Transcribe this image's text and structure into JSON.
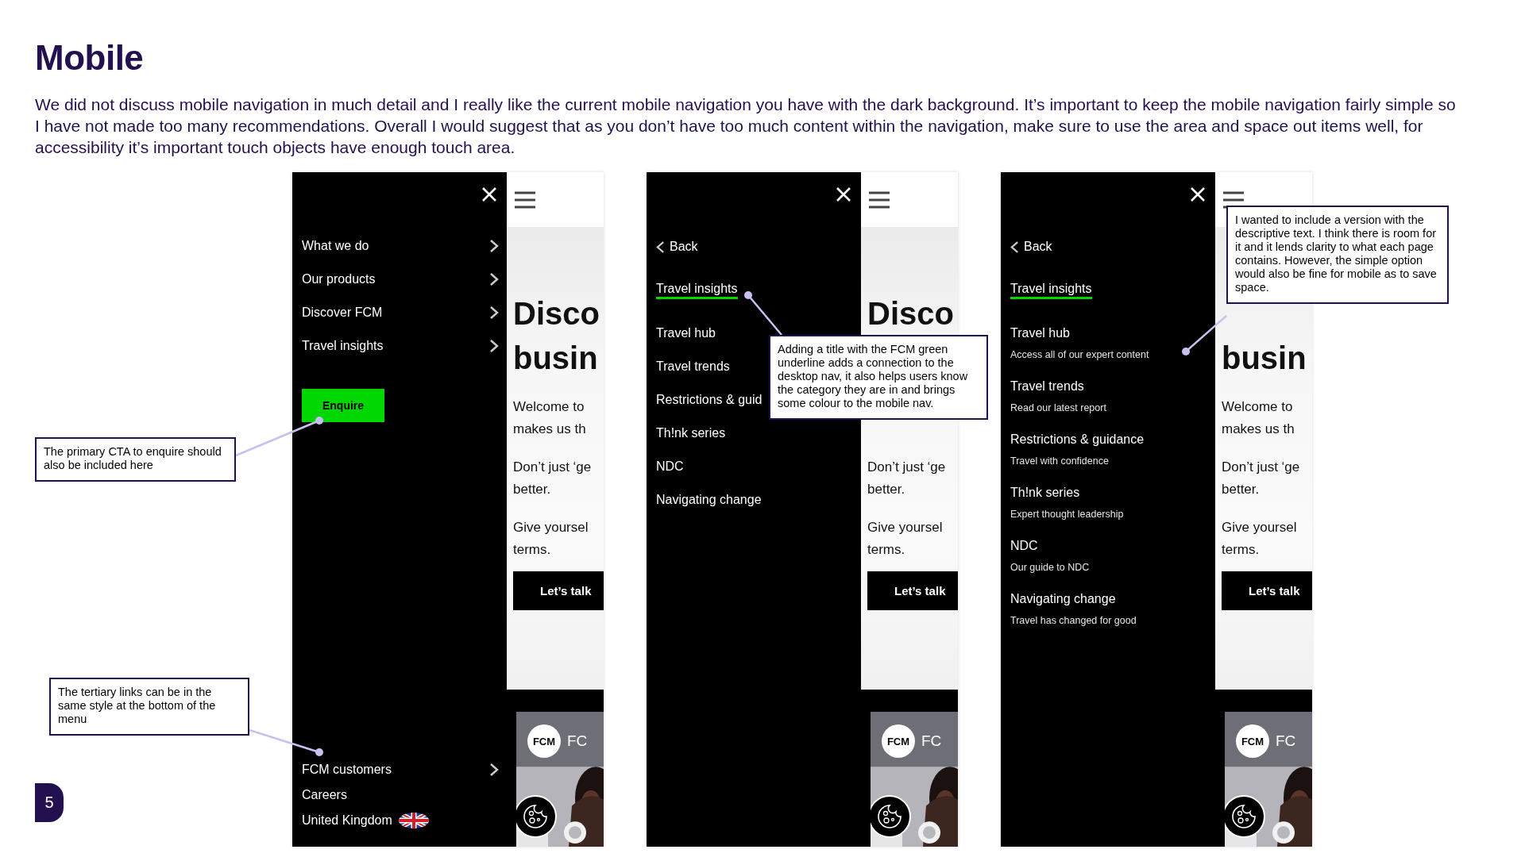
{
  "title": "Mobile",
  "intro": "We did not discuss mobile navigation in much detail and I really like the current mobile navigation you have with the dark background. It’s important to keep the mobile navigation fairly simple so I have not made too many recommendations. Overall I would suggest that as you don’t have too much content within the navigation, make sure to use the area and space out items well, for accessibility it’s important touch objects have enough touch area.",
  "phones": [
    {
      "menu": {
        "kind": "main",
        "items": [
          {
            "label": "What we do",
            "has_submenu": true
          },
          {
            "label": "Our products",
            "has_submenu": true
          },
          {
            "label": "Discover FCM",
            "has_submenu": true
          },
          {
            "label": "Travel insights",
            "has_submenu": true
          }
        ],
        "cta": "Enquire",
        "footer_links": [
          {
            "label": "FCM customers",
            "kind": "submenu"
          },
          {
            "label": "Careers",
            "kind": "link"
          },
          {
            "label": "United Kingdom",
            "kind": "country"
          }
        ]
      },
      "page": {
        "blocks": [
          {
            "kind": "heading",
            "lines": [
              "Disco",
              "busin"
            ],
            "covered": false
          },
          {
            "kind": "para",
            "lines": [
              "Welcome to",
              "makes us th"
            ],
            "covered": false
          },
          {
            "kind": "para",
            "lines": [
              "Don’t just ‘ge",
              "better."
            ],
            "covered": false
          },
          {
            "kind": "para",
            "lines": [
              "Give yoursel",
              "terms."
            ],
            "covered": false
          }
        ],
        "button": "Let’s talk",
        "logo": "FCM",
        "logo_caption": "FC"
      }
    },
    {
      "menu": {
        "kind": "section",
        "back": "Back",
        "section_title": "Travel insights",
        "items": [
          {
            "label": "Travel hub"
          },
          {
            "label": "Travel trends"
          },
          {
            "label": "Restrictions & guid"
          },
          {
            "label": "Th!nk series"
          },
          {
            "label": "NDC"
          },
          {
            "label": "Navigating change"
          }
        ]
      },
      "page": {
        "blocks": [
          {
            "kind": "heading",
            "lines": [
              "Disco"
            ],
            "covered": false
          },
          {
            "kind": "para"
          },
          {
            "kind": "para",
            "lines": [
              "Don’t just ‘ge",
              "better."
            ],
            "covered": false
          },
          {
            "kind": "para",
            "lines": [
              "Give yoursel",
              "terms."
            ],
            "covered": false
          }
        ],
        "button": "Let’s talk",
        "logo": "FCM",
        "logo_caption": "FC"
      }
    },
    {
      "menu": {
        "kind": "section",
        "back": "Back",
        "section_title": "Travel insights",
        "items": [
          {
            "label": "Travel hub",
            "description": "Access all of our expert content"
          },
          {
            "label": "Travel trends",
            "description": "Read our latest report"
          },
          {
            "label": "Restrictions & guidance",
            "description": "Travel with confidence"
          },
          {
            "label": "Th!nk series",
            "description": "Expert thought leadership"
          },
          {
            "label": "NDC",
            "description": "Our guide to NDC"
          },
          {
            "label": "Navigating change",
            "description": "Travel has changed for good"
          }
        ]
      },
      "page": {
        "blocks": [
          {
            "kind": "heading",
            "lines": [
              "busin"
            ],
            "covered": true
          },
          {
            "kind": "para",
            "lines": [
              "Welcome to",
              "makes us th"
            ],
            "covered": false
          },
          {
            "kind": "para",
            "lines": [
              "Don’t just ‘ge",
              "better."
            ],
            "covered": false
          },
          {
            "kind": "para",
            "lines": [
              "Give yoursel",
              "terms."
            ],
            "covered": false
          }
        ],
        "button": "Let’s talk",
        "logo": "FCM",
        "logo_caption": "FC"
      }
    }
  ],
  "notes": [
    {
      "text": "The primary CTA to enquire should also be included here"
    },
    {
      "text": "The tertiary links can be in the same style at the bottom of the menu"
    },
    {
      "text": "Adding a title with the FCM green underline adds a connection to the desktop nav, it also helps users know the category they are in and brings some colour to the mobile nav."
    },
    {
      "text": "I wanted to include a version with the descriptive text. I think there is room for it and it lends clarity to what each page contains. However, the simple option would also be fine for mobile as to save space."
    }
  ],
  "page_number": "5"
}
